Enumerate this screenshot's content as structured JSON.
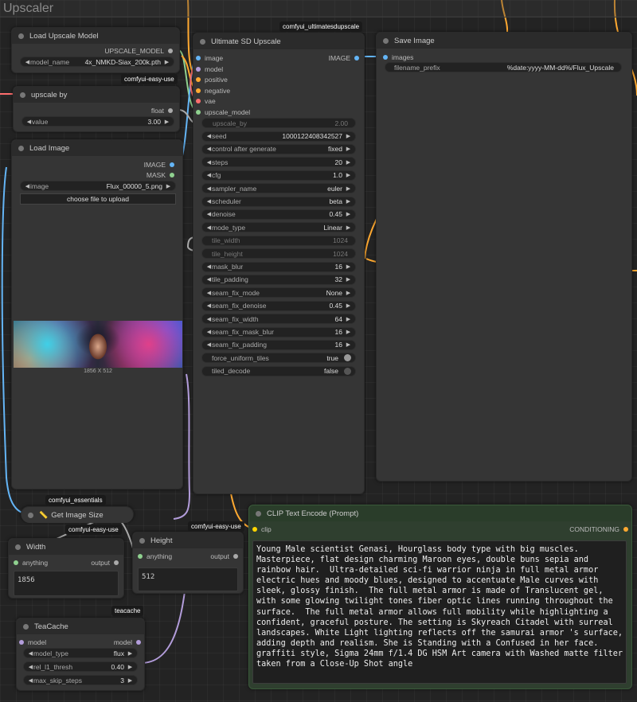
{
  "group": {
    "title": "Upscaler"
  },
  "badges": {
    "ultimatesdupscale": "comfyui_ultimatesdupscale",
    "easyuse1": "comfyui-easy-use",
    "easyuse2": "comfyui-easy-use",
    "easyuse3": "comfyui-easy-use",
    "essentials": "comfyui_essentials",
    "teacache": "teacache"
  },
  "load_upscale_model": {
    "title": "Load Upscale Model",
    "output": "UPSCALE_MODEL",
    "model_name_label": "model_name",
    "model_name_value": "4x_NMKD-Siax_200k.pth"
  },
  "upscale_by": {
    "title": "upscale by",
    "output": "float",
    "value_label": "value",
    "value": "3.00"
  },
  "load_image": {
    "title": "Load Image",
    "out_image": "IMAGE",
    "out_mask": "MASK",
    "image_label": "image",
    "image_value": "Flux_00000_5.png",
    "upload_button": "choose file to upload",
    "dimensions": "1856 X 512"
  },
  "ultimate_sd": {
    "title": "Ultimate SD Upscale",
    "inputs": [
      "image",
      "model",
      "positive",
      "negative",
      "vae",
      "upscale_model"
    ],
    "output": "IMAGE",
    "upscale_by_label": "upscale_by",
    "upscale_by_value": "2.00",
    "widgets": [
      {
        "label": "seed",
        "value": "1000122408342527"
      },
      {
        "label": "control after generate",
        "value": "fixed"
      },
      {
        "label": "steps",
        "value": "20"
      },
      {
        "label": "cfg",
        "value": "1.0"
      },
      {
        "label": "sampler_name",
        "value": "euler"
      },
      {
        "label": "scheduler",
        "value": "beta"
      },
      {
        "label": "denoise",
        "value": "0.45"
      },
      {
        "label": "mode_type",
        "value": "Linear"
      },
      {
        "label": "tile_width",
        "value": "1024"
      },
      {
        "label": "tile_height",
        "value": "1024"
      },
      {
        "label": "mask_blur",
        "value": "16"
      },
      {
        "label": "tile_padding",
        "value": "32"
      },
      {
        "label": "seam_fix_mode",
        "value": "None"
      },
      {
        "label": "seam_fix_denoise",
        "value": "0.45"
      },
      {
        "label": "seam_fix_width",
        "value": "64"
      },
      {
        "label": "seam_fix_mask_blur",
        "value": "16"
      },
      {
        "label": "seam_fix_padding",
        "value": "16"
      },
      {
        "label": "force_uniform_tiles",
        "value": "true"
      },
      {
        "label": "tiled_decode",
        "value": "false"
      }
    ]
  },
  "save_image": {
    "title": "Save Image",
    "input": "images",
    "prefix_label": "filename_prefix",
    "prefix_value": "%date:yyyy-MM-dd%/Flux_Upscale"
  },
  "get_image_size": {
    "title": "Get Image Size"
  },
  "width_node": {
    "title": "Width",
    "input": "anything",
    "output": "output",
    "value": "1856"
  },
  "height_node": {
    "title": "Height",
    "input": "anything",
    "output": "output",
    "value": "512"
  },
  "teacache": {
    "title": "TeaCache",
    "input": "model",
    "output": "model",
    "widgets": [
      {
        "label": "model_type",
        "value": "flux"
      },
      {
        "label": "rel_l1_thresh",
        "value": "0.40"
      },
      {
        "label": "max_skip_steps",
        "value": "3"
      }
    ]
  },
  "clip_text": {
    "title": "CLIP Text Encode (Prompt)",
    "input": "clip",
    "output": "CONDITIONING",
    "text": "Young Male scientist Genasi, Hourglass body type with big muscles. Masterpiece, flat design charming Maroon eyes, double buns sepia and rainbow hair.  Ultra-detailed sci-fi warrior ninja in full metal armor electric hues and moody blues, designed to accentuate Male curves with sleek, glossy finish.  The full metal armor is made of Translucent gel, with some glowing twilight tones fiber optic lines running throughout the surface.  The full metal armor allows full mobility while highlighting a confident, graceful posture. The setting is Skyreach Citadel with surreal landscapes. White Light lighting reflects off the samurai armor 's surface, adding depth and realism. She is Standing with a Confused in her face. graffiti style, Sigma 24mm f/1.4 DG HSM Art camera with Washed matte filter taken from a Close-Up Shot angle"
  },
  "colors": {
    "image_slot": "#64b5f6",
    "model_slot": "#b39ddb",
    "conditioning_slot": "#ffa931",
    "vae_slot": "#ff6e6e",
    "upscale_slot": "#8fd18f",
    "float_slot": "#aaaaaa",
    "clip_header": "#2a3d2a"
  }
}
